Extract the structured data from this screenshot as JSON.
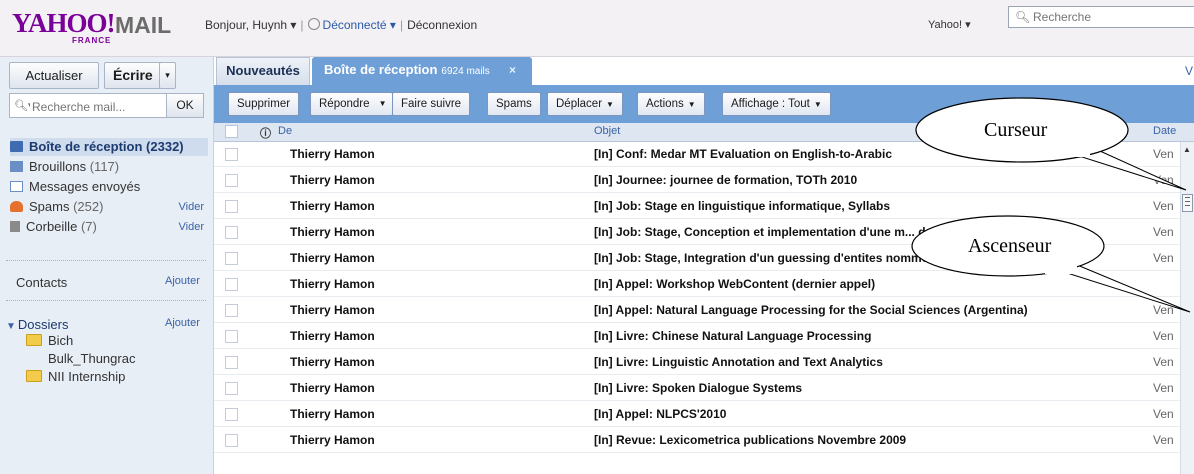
{
  "header": {
    "logo": "YAHOO!",
    "logo_mail": "MAIL",
    "logo_region": "FRANCE",
    "greeting": "Bonjour, Huynh ▾",
    "status": "Déconnecté ▾",
    "logout": "Déconnexion",
    "yahoo_menu": "Yahoo! ▾",
    "search_placeholder": "Recherche"
  },
  "sidebar": {
    "refresh": "Actualiser",
    "compose": "Écrire",
    "compose_arrow": "▾",
    "search_placeholder": "Recherche mail...",
    "search_ok": "OK",
    "folders": [
      {
        "label": "Boîte de réception",
        "count": "(2332)",
        "action": ""
      },
      {
        "label": "Brouillons",
        "count": "(117)",
        "action": ""
      },
      {
        "label": "Messages envoyés",
        "count": "",
        "action": ""
      },
      {
        "label": "Spams",
        "count": "(252)",
        "action": "Vider"
      },
      {
        "label": "Corbeille",
        "count": "(7)",
        "action": "Vider"
      }
    ],
    "contacts": "Contacts",
    "contacts_add": "Ajouter",
    "dossiers": "Dossiers",
    "dossiers_add": "Ajouter",
    "subfolders": [
      "Bich",
      "Bulk_Thungrac",
      "NII Internship"
    ]
  },
  "tabs": {
    "news": "Nouveautés",
    "inbox": "Boîte de réception",
    "inbox_count": "6924 mails",
    "close": "×",
    "right_link": "V"
  },
  "toolbar": {
    "delete": "Supprimer",
    "reply": "Répondre",
    "forward": "Faire suivre",
    "spam": "Spams",
    "move": "Déplacer",
    "actions": "Actions",
    "view": "Affichage : Tout"
  },
  "table": {
    "headers": {
      "from": "De",
      "subject": "Objet",
      "date": "Date"
    },
    "rows": [
      {
        "from": "Thierry Hamon",
        "subject": "[In] Conf: Medar MT Evaluation on English-to-Arabic",
        "date": "Ven"
      },
      {
        "from": "Thierry Hamon",
        "subject": "[In] Journee: journee de formation, TOTh 2010",
        "date": "Ven"
      },
      {
        "from": "Thierry Hamon",
        "subject": "[In] Job: Stage en linguistique informatique, Syllabs",
        "date": "Ven"
      },
      {
        "from": "Thierry Hamon",
        "subject": "[In] Job: Stage, Conception et implementation d'une m... de r...",
        "date": "Ven"
      },
      {
        "from": "Thierry Hamon",
        "subject": "[In] Job: Stage, Integration d'un guessing d'entites nommees, Syllabs",
        "date": "Ven"
      },
      {
        "from": "Thierry Hamon",
        "subject": "[In] Appel: Workshop WebContent (dernier appel)",
        "date": ""
      },
      {
        "from": "Thierry Hamon",
        "subject": "[In] Appel: Natural Language Processing for the Social Sciences (Argentina)",
        "date": "Ven"
      },
      {
        "from": "Thierry Hamon",
        "subject": "[In] Livre: Chinese Natural Language Processing",
        "date": "Ven"
      },
      {
        "from": "Thierry Hamon",
        "subject": "[In] Livre: Linguistic Annotation and Text Analytics",
        "date": "Ven"
      },
      {
        "from": "Thierry Hamon",
        "subject": "[In] Livre: Spoken Dialogue Systems",
        "date": "Ven"
      },
      {
        "from": "Thierry Hamon",
        "subject": "[In] Appel: NLPCS'2010",
        "date": "Ven"
      },
      {
        "from": "Thierry Hamon",
        "subject": "[In] Revue: Lexicometrica publications Novembre 2009",
        "date": "Ven"
      }
    ]
  },
  "callouts": {
    "cursor": "Curseur",
    "scrollbar": "Ascenseur"
  },
  "colors": {
    "brand": "#7b0099",
    "accent": "#6e9fd6",
    "link": "#3a62a7"
  }
}
